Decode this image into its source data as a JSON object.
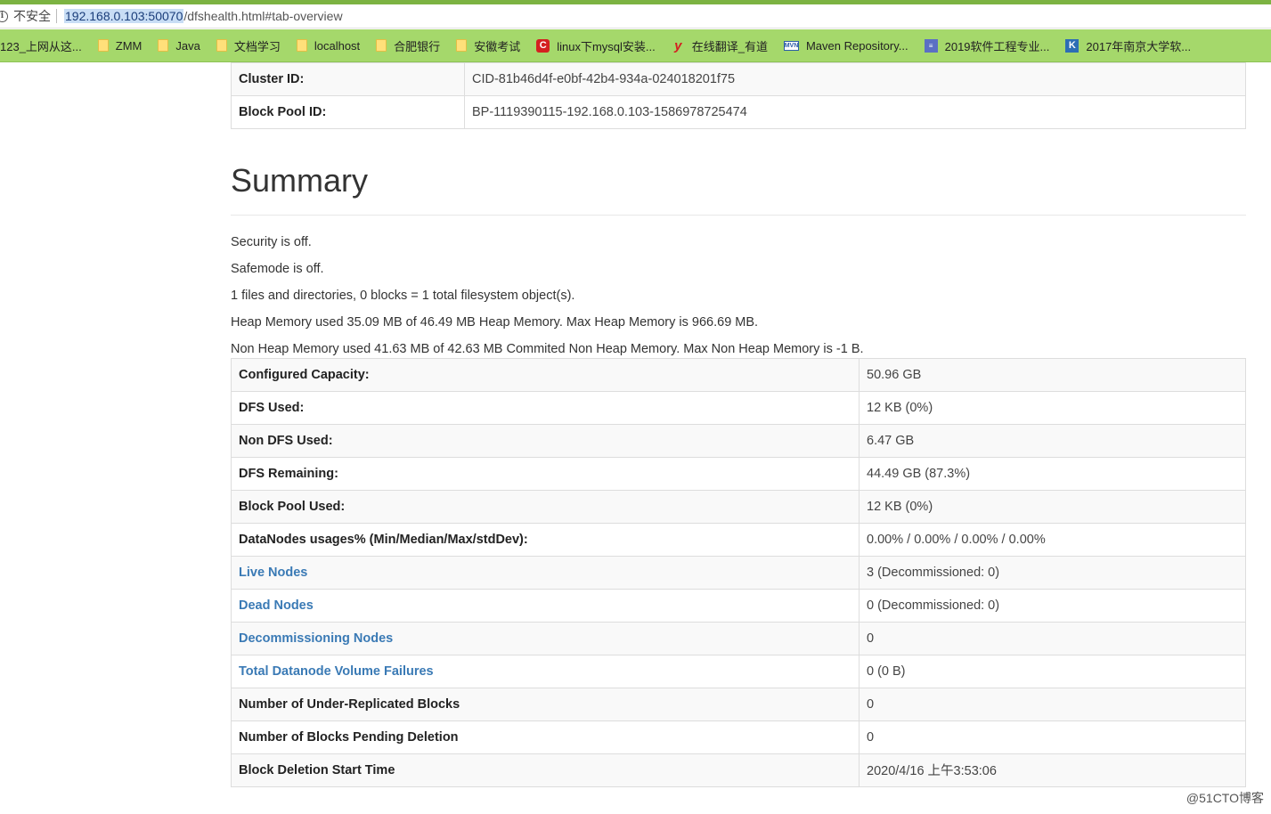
{
  "browser": {
    "insecure_label": "不安全",
    "url_host": "192.168.0.103:50070",
    "url_path": "/dfshealth.html#tab-overview",
    "bookmarks": [
      {
        "label": "123_上网从这...",
        "icon": "none"
      },
      {
        "label": "ZMM",
        "icon": "folder-icon"
      },
      {
        "label": "Java",
        "icon": "folder-icon"
      },
      {
        "label": "文档学习",
        "icon": "folder-icon"
      },
      {
        "label": "localhost",
        "icon": "folder-icon"
      },
      {
        "label": "合肥银行",
        "icon": "folder-icon"
      },
      {
        "label": "安徽考试",
        "icon": "folder-icon"
      },
      {
        "label": "linux下mysql安装...",
        "icon": "csdn-icon"
      },
      {
        "label": "在线翻译_有道",
        "icon": "youdao-icon"
      },
      {
        "label": "Maven Repository...",
        "icon": "maven-icon"
      },
      {
        "label": "2019软件工程专业...",
        "icon": "document-icon"
      },
      {
        "label": "2017年南京大学软...",
        "icon": "k-icon"
      }
    ]
  },
  "cluster": {
    "rows": [
      {
        "key": "Cluster ID:",
        "value": "CID-81b46d4f-e0bf-42b4-934a-024018201f75"
      },
      {
        "key": "Block Pool ID:",
        "value": "BP-1119390115-192.168.0.103-1586978725474"
      }
    ]
  },
  "summary": {
    "title": "Summary",
    "lines": [
      "Security is off.",
      "Safemode is off.",
      "1 files and directories, 0 blocks = 1 total filesystem object(s).",
      "Heap Memory used 35.09 MB of 46.49 MB Heap Memory. Max Heap Memory is 966.69 MB.",
      "Non Heap Memory used 41.63 MB of 42.63 MB Commited Non Heap Memory. Max Non Heap Memory is -1 B."
    ],
    "rows": [
      {
        "key": "Configured Capacity:",
        "value": "50.96 GB",
        "link": false
      },
      {
        "key": "DFS Used:",
        "value": "12 KB (0%)",
        "link": false
      },
      {
        "key": "Non DFS Used:",
        "value": "6.47 GB",
        "link": false
      },
      {
        "key": "DFS Remaining:",
        "value": "44.49 GB (87.3%)",
        "link": false
      },
      {
        "key": "Block Pool Used:",
        "value": "12 KB (0%)",
        "link": false
      },
      {
        "key": "DataNodes usages% (Min/Median/Max/stdDev):",
        "value": "0.00% / 0.00% / 0.00% / 0.00%",
        "link": false
      },
      {
        "key": "Live Nodes",
        "value": "3 (Decommissioned: 0)",
        "link": true
      },
      {
        "key": "Dead Nodes",
        "value": "0 (Decommissioned: 0)",
        "link": true
      },
      {
        "key": "Decommissioning Nodes",
        "value": "0",
        "link": true
      },
      {
        "key": "Total Datanode Volume Failures",
        "value": "0 (0 B)",
        "link": true
      },
      {
        "key": "Number of Under-Replicated Blocks",
        "value": "0",
        "link": false
      },
      {
        "key": "Number of Blocks Pending Deletion",
        "value": "0",
        "link": false
      },
      {
        "key": "Block Deletion Start Time",
        "value": "2020/4/16 上午3:53:06",
        "link": false
      }
    ]
  },
  "watermark": "@51CTO博客",
  "colors": {
    "link": "#3a7ab5",
    "bookmark_bar": "#a5d86b",
    "url_highlight": "#c8ddf5"
  }
}
